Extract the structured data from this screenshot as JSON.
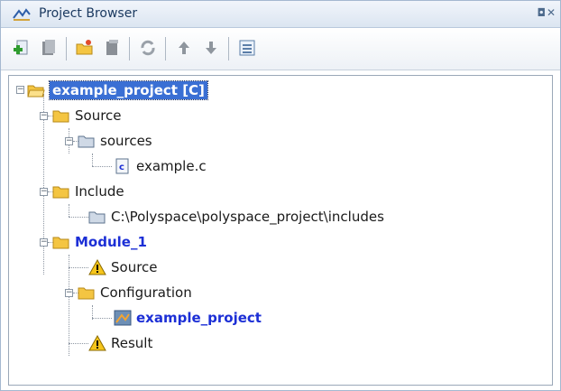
{
  "window": {
    "title": "Project Browser",
    "controls": "◘✕"
  },
  "toolbar": {
    "buttons": [
      {
        "name": "new-project-button",
        "icon": "add-icon"
      },
      {
        "name": "project-properties-button",
        "icon": "database-icon"
      },
      {
        "name": "open-folder-button",
        "icon": "folder-open-icon"
      },
      {
        "name": "copy-button",
        "icon": "copy-icon"
      },
      {
        "name": "refresh-button",
        "icon": "refresh-icon"
      },
      {
        "name": "move-up-button",
        "icon": "arrow-up-icon"
      },
      {
        "name": "move-down-button",
        "icon": "arrow-down-icon"
      },
      {
        "name": "view-list-button",
        "icon": "list-icon"
      }
    ]
  },
  "tree": {
    "root": "example_project [C]",
    "source": "Source",
    "sources": "sources",
    "file": "example.c",
    "include": "Include",
    "include_path": "C:\\Polyspace\\polyspace_project\\includes",
    "module": "Module_1",
    "module_source": "Source",
    "configuration": "Configuration",
    "config_item": "example_project",
    "result": "Result"
  },
  "colors": {
    "selection": "#3a6fd4",
    "link_blue": "#1c2fd6",
    "folder": "#f4c542"
  }
}
